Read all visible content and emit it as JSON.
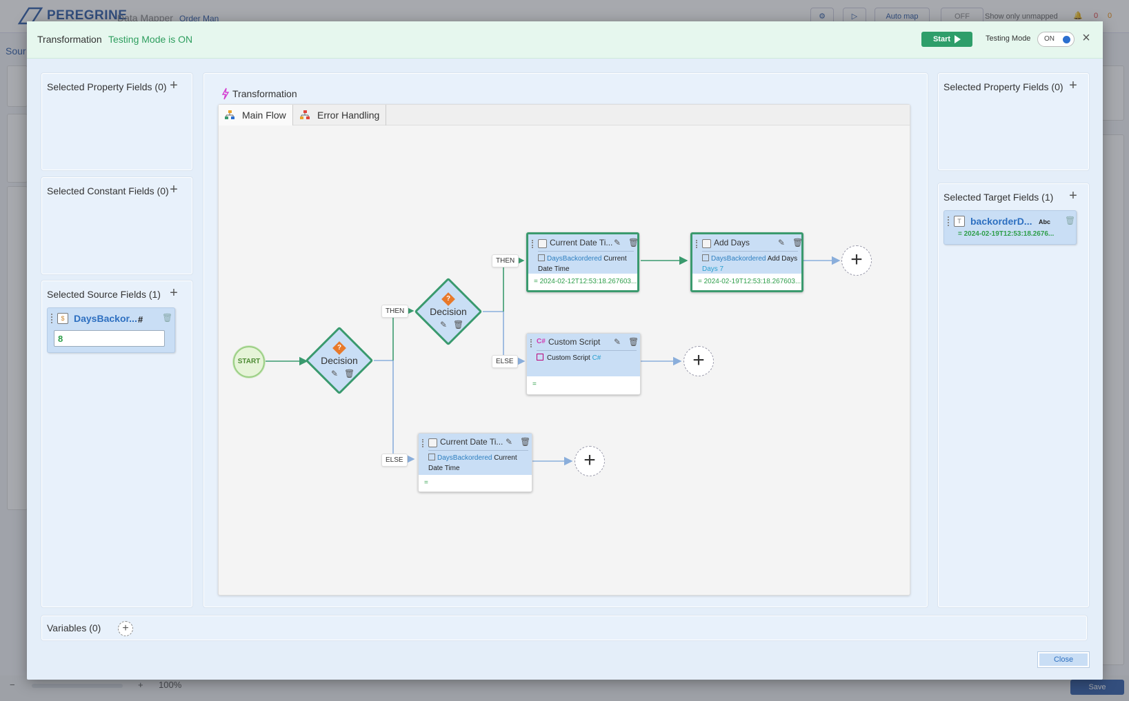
{
  "background": {
    "brand": "PEREGRINE",
    "brand_sub": "Data Mapper",
    "brand_link": "Order Man",
    "auto_map": "Auto map",
    "unmapped_toggle": "OFF",
    "show_unmapped": "Show only unmapped",
    "notif_a": "0",
    "notif_b": "0",
    "source_link": "Sour",
    "zoom": "100%",
    "save": "Save"
  },
  "modal": {
    "title": "Transformation",
    "status": "Testing Mode is ON",
    "start_label": "Start",
    "testing_mode_label": "Testing Mode",
    "toggle_state": "ON",
    "close_label": "Close"
  },
  "left": {
    "property_fields_title": "Selected Property Fields (0)",
    "constant_fields_title": "Selected Constant Fields (0)",
    "source_fields_title": "Selected Source Fields (1)",
    "source_field": {
      "name": "DaysBackor...",
      "type_symbol": "#",
      "value": "8"
    }
  },
  "right": {
    "property_fields_title": "Selected Property Fields (0)",
    "target_fields_title": "Selected Target Fields (1)",
    "target_field": {
      "name": "backorderD...",
      "type_symbol": "Abc",
      "value": "= 2024-02-19T12:53:18.2676..."
    }
  },
  "transformation": {
    "title": "Transformation",
    "tabs": [
      "Main Flow",
      "Error Handling"
    ],
    "start_node": "START",
    "decision_label": "Decision",
    "then_label": "THEN",
    "else_label": "ELSE",
    "steps": {
      "current_date_1": {
        "title": "Current Date Ti...",
        "field": "DaysBackordered",
        "op": "Current",
        "op2": "Date Time",
        "result": "= 2024-02-12T12:53:18.267603..."
      },
      "add_days": {
        "title": "Add Days",
        "field": "DaysBackordered",
        "op": "Add",
        "op2": "Days",
        "param": "Days 7",
        "result": "= 2024-02-19T12:53:18.267603..."
      },
      "custom_script": {
        "prefix": "C#",
        "title": "Custom Script",
        "body": "Custom Script",
        "body_tag": "C#",
        "result": "="
      },
      "current_date_2": {
        "title": "Current Date Ti...",
        "field": "DaysBackordered",
        "op": "Current",
        "op2": "Date Time",
        "result": "="
      }
    }
  },
  "variables": {
    "title": "Variables (0)"
  },
  "colors": {
    "accent_green": "#2e9e6a",
    "node_border": "#3a9a6e",
    "card_blue": "#c9def5",
    "link_blue": "#2d6fc0"
  }
}
